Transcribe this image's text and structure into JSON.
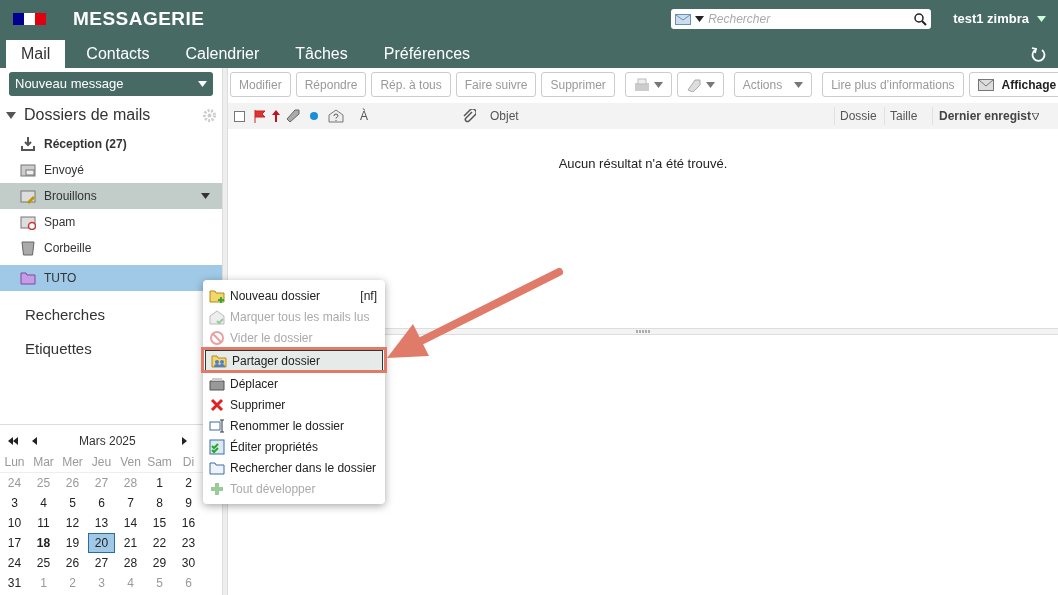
{
  "header": {
    "title": "MESSAGERIE",
    "search": {
      "placeholder": "Rechercher"
    },
    "user": "test1 zimbra"
  },
  "tabs": [
    {
      "label": "Mail",
      "selected": true
    },
    {
      "label": "Contacts",
      "selected": false
    },
    {
      "label": "Calendrier",
      "selected": false
    },
    {
      "label": "Tâches",
      "selected": false
    },
    {
      "label": "Préférences",
      "selected": false
    }
  ],
  "new_message": "Nouveau message",
  "toolbar": [
    {
      "kind": "text",
      "label": "Modifier",
      "disabled": true
    },
    {
      "kind": "text",
      "label": "Répondre",
      "disabled": true
    },
    {
      "kind": "text",
      "label": "Rép. à tous",
      "disabled": true
    },
    {
      "kind": "text",
      "label": "Faire suivre",
      "disabled": true
    },
    {
      "kind": "text",
      "label": "Supprimer",
      "disabled": true
    },
    {
      "kind": "print",
      "disabled": true
    },
    {
      "kind": "tag",
      "disabled": true
    },
    {
      "kind": "menu",
      "label": "Actions",
      "disabled": true
    },
    {
      "kind": "text",
      "label": "Lire plus d’informations",
      "disabled": true
    },
    {
      "kind": "view",
      "label": "Affichage",
      "disabled": false
    }
  ],
  "sidebar": {
    "title": "Dossiers de mails",
    "expanded": true,
    "folders": [
      {
        "kind": "inbox",
        "label": "Réception (27)",
        "unread": true,
        "selected": false
      },
      {
        "kind": "sent",
        "label": "Envoyé",
        "unread": false,
        "selected": false
      },
      {
        "kind": "drafts",
        "label": "Brouillons",
        "unread": false,
        "selected": false,
        "hovered": true
      },
      {
        "kind": "spam",
        "label": "Spam",
        "unread": false,
        "selected": false
      },
      {
        "kind": "trash",
        "label": "Corbeille",
        "unread": false,
        "selected": false
      },
      {
        "kind": "folder",
        "label": "TUTO",
        "unread": false,
        "selected": true
      }
    ],
    "sections": [
      "Recherches",
      "Etiquettes"
    ]
  },
  "calendar": {
    "month": "Mars 2025",
    "weekdays": [
      "Lun",
      "Mar",
      "Mer",
      "Jeu",
      "Ven",
      "Sam",
      "Di"
    ],
    "weeks": [
      [
        {
          "d": "24",
          "other": true
        },
        {
          "d": "25",
          "other": true
        },
        {
          "d": "26",
          "other": true
        },
        {
          "d": "27",
          "other": true
        },
        {
          "d": "28",
          "other": true
        },
        {
          "d": "1"
        },
        {
          "d": "2"
        }
      ],
      [
        {
          "d": "3"
        },
        {
          "d": "4"
        },
        {
          "d": "5"
        },
        {
          "d": "6"
        },
        {
          "d": "7"
        },
        {
          "d": "8"
        },
        {
          "d": "9"
        }
      ],
      [
        {
          "d": "10"
        },
        {
          "d": "11"
        },
        {
          "d": "12"
        },
        {
          "d": "13"
        },
        {
          "d": "14"
        },
        {
          "d": "15"
        },
        {
          "d": "16"
        }
      ],
      [
        {
          "d": "17"
        },
        {
          "d": "18",
          "today": true
        },
        {
          "d": "19"
        },
        {
          "d": "20",
          "selected": true
        },
        {
          "d": "21"
        },
        {
          "d": "22"
        },
        {
          "d": "23"
        }
      ],
      [
        {
          "d": "24"
        },
        {
          "d": "25"
        },
        {
          "d": "26"
        },
        {
          "d": "27"
        },
        {
          "d": "28"
        },
        {
          "d": "29"
        },
        {
          "d": "30"
        }
      ],
      [
        {
          "d": "31"
        },
        {
          "d": "1",
          "other": true
        },
        {
          "d": "2",
          "other": true
        },
        {
          "d": "3",
          "other": true
        },
        {
          "d": "4",
          "other": true
        },
        {
          "d": "5",
          "other": true
        },
        {
          "d": "6",
          "other": true
        }
      ]
    ]
  },
  "list": {
    "select_all_checked": false,
    "columns": {
      "to": "À",
      "subject": "Objet",
      "folder": "Dossie",
      "size": "Taille",
      "date": "Dernier enregist"
    },
    "empty": "Aucun résultat n'a été trouvé."
  },
  "context_menu": [
    {
      "kind": "new-folder",
      "label": "Nouveau dossier",
      "shortcut": "[nf]",
      "disabled": false,
      "selected": false
    },
    {
      "kind": "mark-read",
      "label": "Marquer tous les mails lus",
      "disabled": true,
      "selected": false
    },
    {
      "kind": "empty",
      "label": "Vider le dossier",
      "disabled": true,
      "selected": false
    },
    {
      "kind": "share",
      "label": "Partager dossier",
      "disabled": false,
      "selected": true
    },
    {
      "kind": "move",
      "label": "Déplacer",
      "disabled": false,
      "selected": false
    },
    {
      "kind": "delete",
      "label": "Supprimer",
      "disabled": false,
      "selected": false
    },
    {
      "kind": "rename",
      "label": "Renommer le dossier",
      "disabled": false,
      "selected": false
    },
    {
      "kind": "edit",
      "label": "Éditer propriétés",
      "disabled": false,
      "selected": false
    },
    {
      "kind": "search",
      "label": "Rechercher dans le dossier",
      "disabled": false,
      "selected": false
    },
    {
      "kind": "expand",
      "label": "Tout développer",
      "disabled": true,
      "selected": false
    }
  ]
}
